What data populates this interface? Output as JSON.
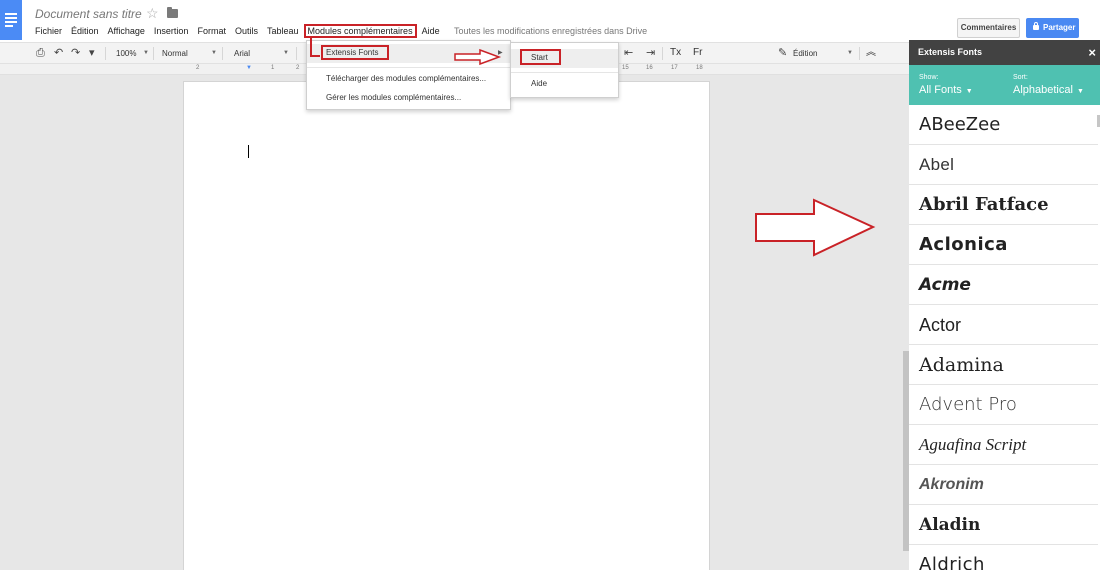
{
  "header": {
    "title": "Document sans titre",
    "menu": [
      "Fichier",
      "Édition",
      "Affichage",
      "Insertion",
      "Format",
      "Outils",
      "Tableau",
      "Modules complémentaires",
      "Aide"
    ],
    "save_status": "Toutes les modifications enregistrées dans Drive",
    "comments_label": "Commentaires",
    "share_label": "Partager"
  },
  "toolbar": {
    "zoom": "100%",
    "style": "Normal",
    "font": "Arial",
    "clear_format": "Tx",
    "language": "Fr",
    "mode": "Édition"
  },
  "ruler": [
    "2",
    "1",
    "1",
    "2",
    "15",
    "16",
    "17",
    "18"
  ],
  "addons_menu": {
    "items": [
      "Extensis Fonts",
      "Télécharger des modules complémentaires...",
      "Gérer les modules complémentaires..."
    ]
  },
  "submenu": {
    "items": [
      "Start",
      "Aide"
    ]
  },
  "sidebar": {
    "title": "Extensis Fonts",
    "show_label": "Show:",
    "show_value": "All Fonts",
    "sort_label": "Sort:",
    "sort_value": "Alphabetical",
    "fonts": [
      "ABeeZee",
      "Abel",
      "Abril Fatface",
      "Aclonica",
      "Acme",
      "Actor",
      "Adamina",
      "Advent Pro",
      "Aguafina Script",
      "Akronim",
      "Aladin",
      "Aldrich"
    ]
  },
  "colors": {
    "accent_blue": "#4a89f2",
    "annotation_red": "#c92227",
    "sidebar_header": "#424242",
    "sidebar_filter": "#4fc1b1"
  }
}
